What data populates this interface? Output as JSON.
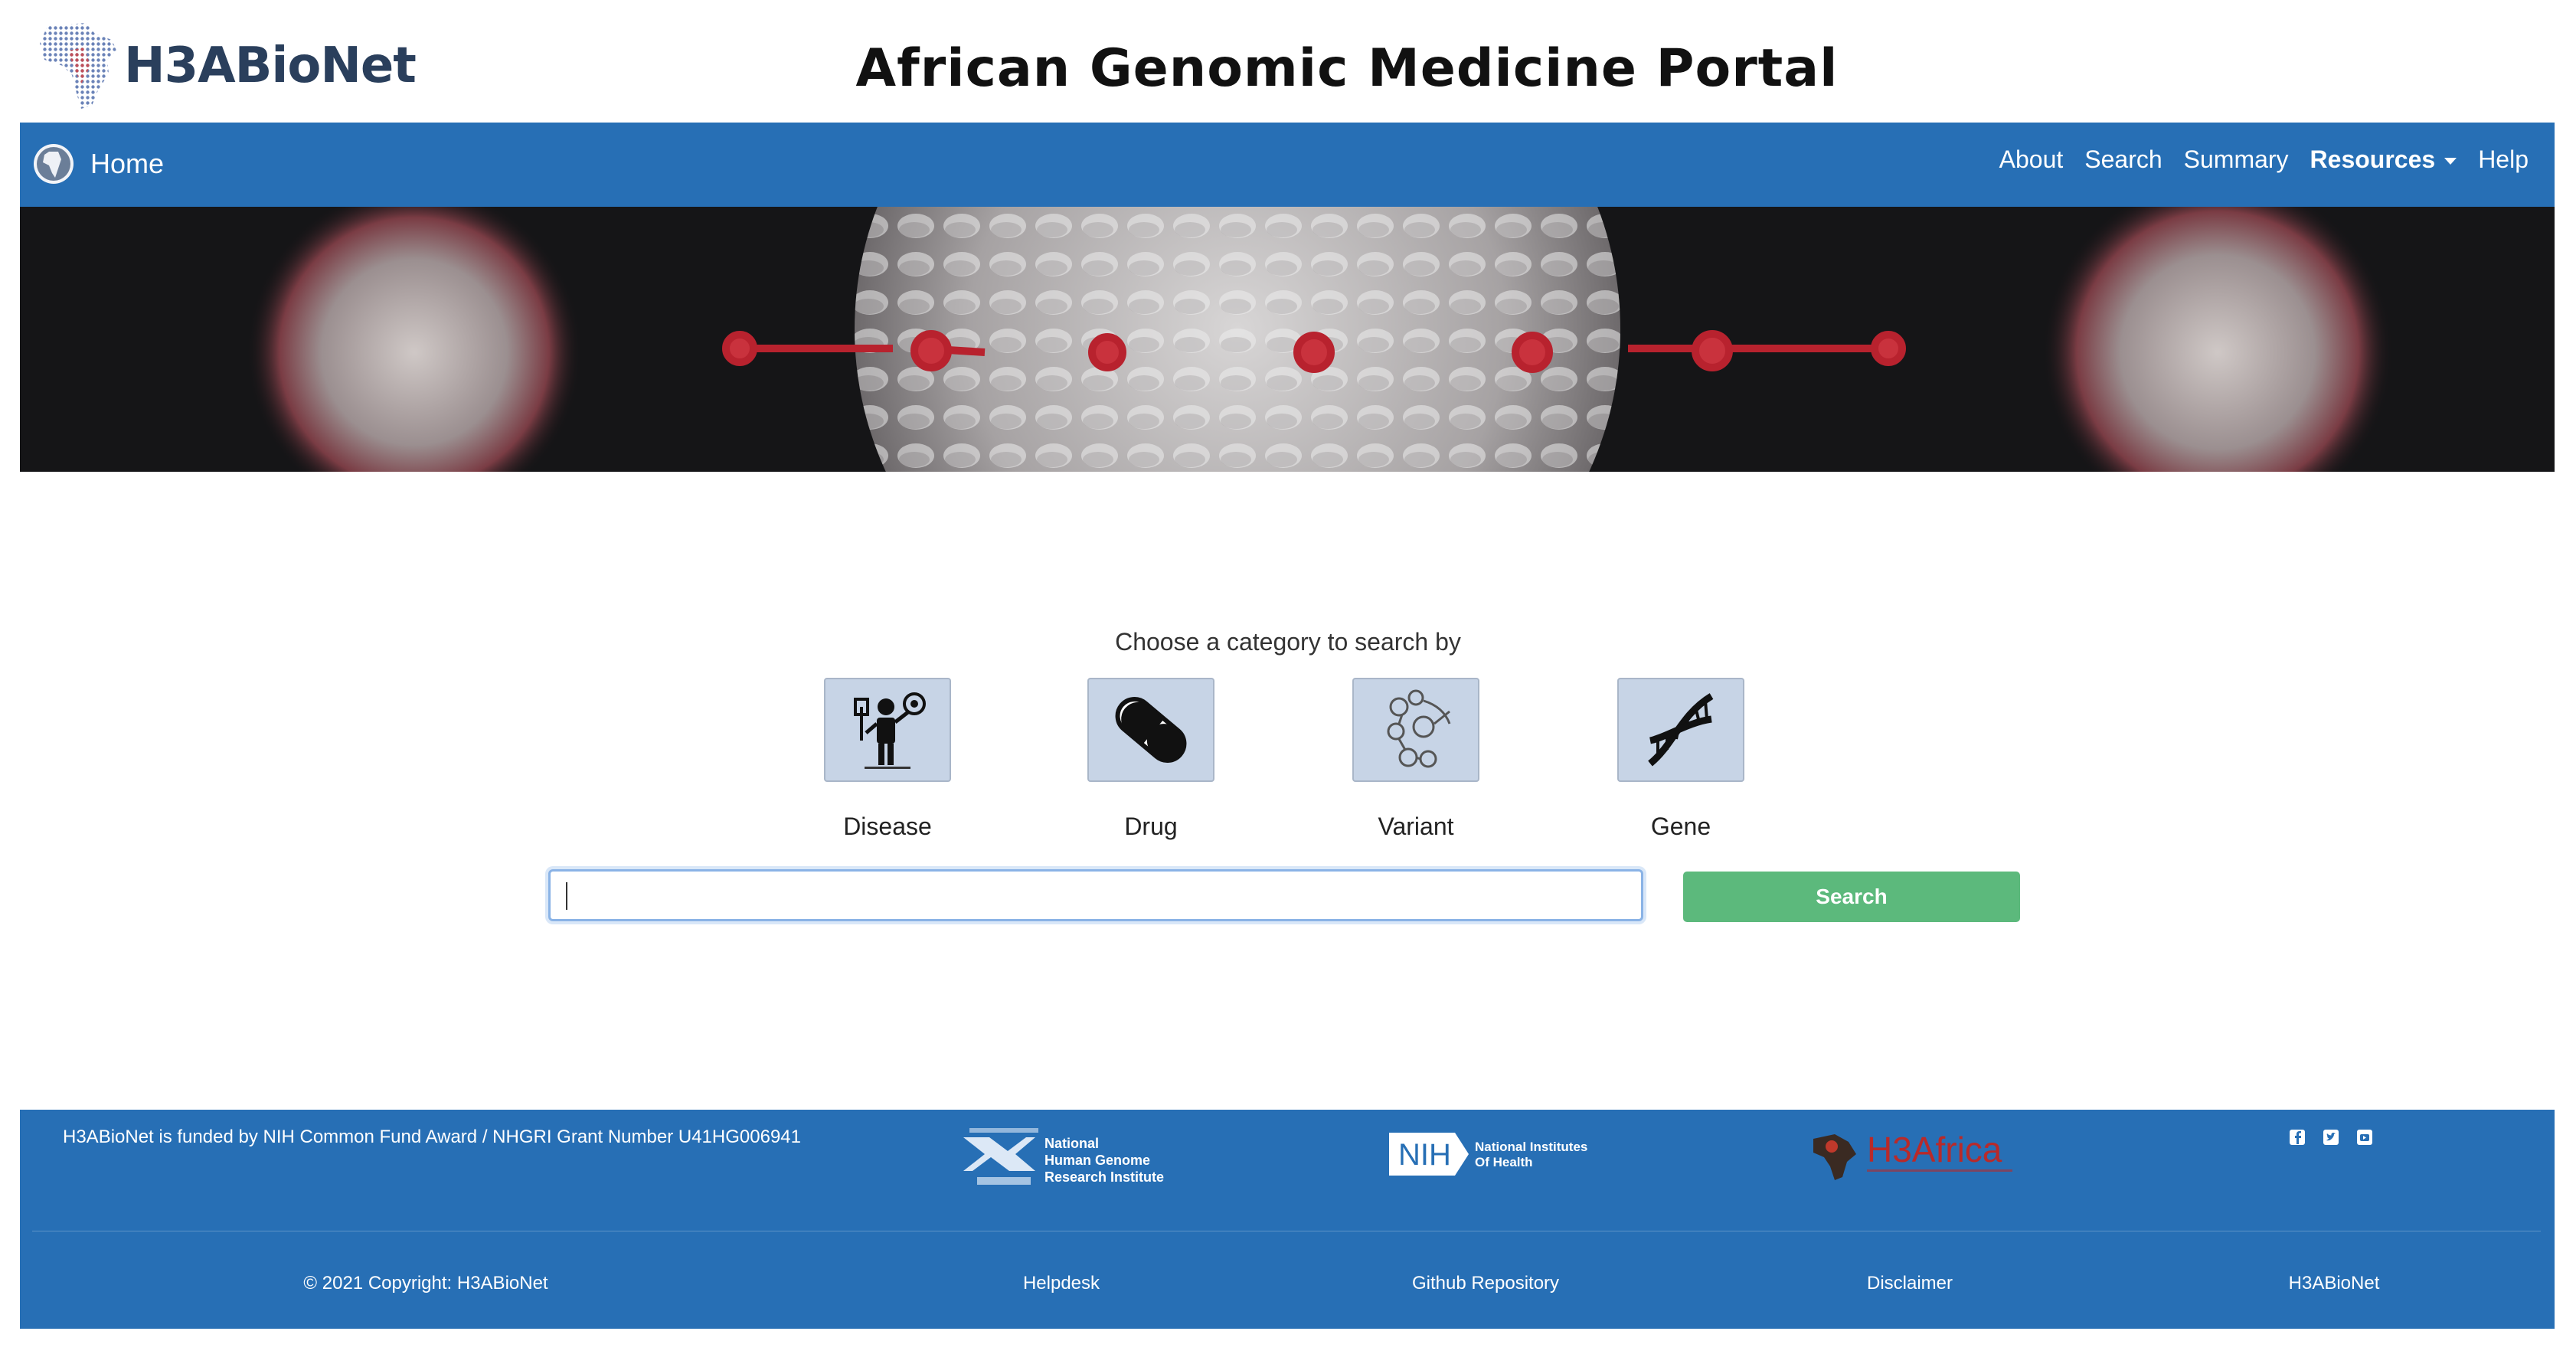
{
  "header": {
    "logo_text": "H3ABioNet",
    "title": "African Genomic Medicine Portal"
  },
  "nav": {
    "home": "Home",
    "links": [
      "About",
      "Search",
      "Summary",
      "Resources",
      "Help"
    ]
  },
  "main": {
    "prompt": "Choose a category to search by",
    "categories": [
      {
        "label": "Disease",
        "icon": "disease-icon"
      },
      {
        "label": "Drug",
        "icon": "pill-icon"
      },
      {
        "label": "Variant",
        "icon": "variant-icon"
      },
      {
        "label": "Gene",
        "icon": "dna-icon"
      }
    ],
    "search_value": "",
    "search_button": "Search"
  },
  "footer": {
    "funded_text": "H3ABioNet is funded by NIH Common Fund Award / NHGRI Grant Number U41HG006941",
    "nhgri_lines": [
      "National",
      "Human Genome",
      "Research Institute"
    ],
    "nih_abbr": "NIH",
    "nih_lines": [
      "National Institutes",
      "Of Health"
    ],
    "h3africa_text": "H3Africa",
    "social_icons": [
      "facebook-icon",
      "twitter-icon",
      "youtube-icon"
    ],
    "copyright": "© 2021 Copyright: H3ABioNet",
    "links": [
      "Helpdesk",
      "Github Repository",
      "Disclaimer",
      "H3ABioNet"
    ]
  },
  "colors": {
    "nav_blue": "#276fb5",
    "search_green": "#5cb97c",
    "tile_bg": "#c7d4e6"
  }
}
